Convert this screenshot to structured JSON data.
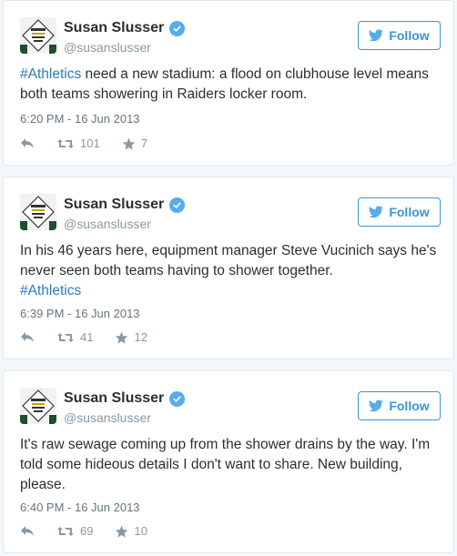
{
  "colors": {
    "link": "#2b7bb9",
    "verified": "#55acee",
    "follow": "#3b94d9",
    "meta": "#8899a6"
  },
  "tweets": [
    {
      "author": {
        "name": "Susan Slusser",
        "handle": "@susanslusser",
        "verified": true
      },
      "follow_label": "Follow",
      "hashtag": "#Athletics",
      "text_after_hashtag": " need a new stadium: a flood on clubhouse level means both teams showering in Raiders locker room.",
      "timestamp": "6:20 PM - 16 Jun 2013",
      "retweets": "101",
      "likes": "7"
    },
    {
      "author": {
        "name": "Susan Slusser",
        "handle": "@susanslusser",
        "verified": true
      },
      "follow_label": "Follow",
      "text": "In his 46 years here, equipment manager Steve Vucinich says he's never seen both teams having to shower together.",
      "hashtag": "#Athletics",
      "timestamp": "6:39 PM - 16 Jun 2013",
      "retweets": "41",
      "likes": "12"
    },
    {
      "author": {
        "name": "Susan Slusser",
        "handle": "@susanslusser",
        "verified": true
      },
      "follow_label": "Follow",
      "text": "It's raw sewage coming up from the shower drains by the way. I'm told some hideous details I don't want to share. New building, please.",
      "timestamp": "6:40 PM - 16 Jun 2013",
      "retweets": "69",
      "likes": "10"
    }
  ]
}
